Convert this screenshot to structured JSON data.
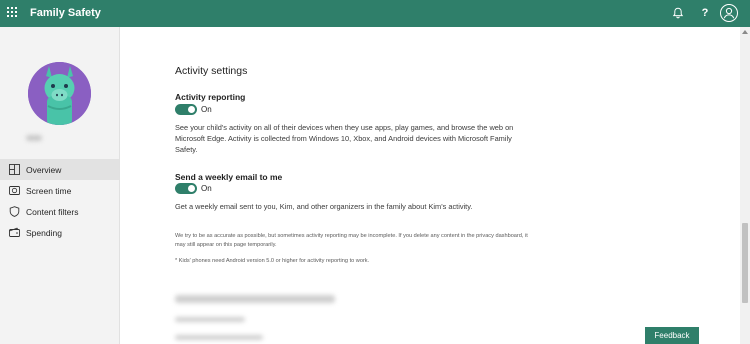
{
  "header": {
    "app_title": "Family Safety",
    "help_label": "?",
    "icons": [
      "apps-grid-icon",
      "bell-icon",
      "help-icon",
      "account-icon"
    ]
  },
  "sidebar": {
    "nav_items": [
      {
        "label": "Overview",
        "icon": "overview-icon",
        "active": true
      },
      {
        "label": "Screen time",
        "icon": "clock-icon",
        "active": false
      },
      {
        "label": "Content filters",
        "icon": "shield-icon",
        "active": false
      },
      {
        "label": "Spending",
        "icon": "wallet-icon",
        "active": false
      }
    ]
  },
  "main": {
    "section_title": "Activity settings",
    "activity_reporting": {
      "label": "Activity reporting",
      "state_text": "On",
      "description": "See your child's activity on all of their devices when they use apps, play games, and browse the web on Microsoft Edge. Activity is collected from Windows 10, Xbox, and Android devices with Microsoft Family Safety."
    },
    "weekly_email": {
      "label": "Send a weekly email to me",
      "state_text": "On",
      "description": "Get a weekly email sent to you, Kim, and other organizers in the family about Kim's activity."
    },
    "notes": [
      "We try to be as accurate as possible, but sometimes activity reporting may be incomplete. If you delete any content in the privacy dashboard, it may still appear on this page temporarily.",
      "* Kids' phones need Android version 5.0 or higher for activity reporting to work."
    ]
  },
  "feedback_label": "Feedback",
  "colors": {
    "brand": "#2f7f6a",
    "sidebar_bg": "#f3f3f3",
    "avatar_bg": "#8a5fc2"
  }
}
